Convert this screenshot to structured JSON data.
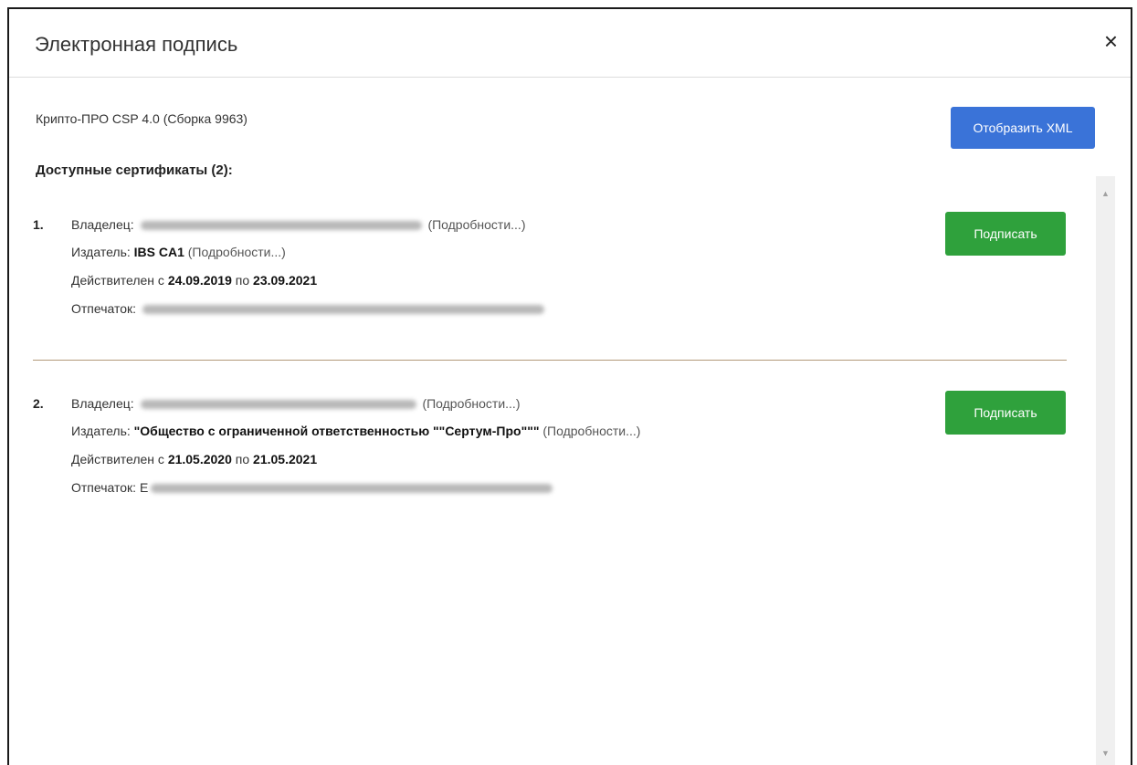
{
  "dialog": {
    "title": "Электронная подпись",
    "close_glyph": "×"
  },
  "csp_info": "Крипто-ПРО CSP 4.0 (Сборка 9963)",
  "xml_button_label": "Отобразить XML",
  "certs_heading": "Доступные сертификаты (2):",
  "certificates": [
    {
      "number": "1.",
      "owner_label": "Владелец:",
      "owner_details": "(Подробности...)",
      "issuer_label": "Издатель:",
      "issuer_value": "IBS CA1",
      "issuer_details": "(Подробности...)",
      "valid_prefix": "Действителен с",
      "valid_from": "24.09.2019",
      "valid_mid": "по",
      "valid_to": "23.09.2021",
      "thumbprint_label": "Отпечаток:",
      "sign_label": "Подписать"
    },
    {
      "number": "2.",
      "owner_label": "Владелец:",
      "owner_details": "(Подробности...)",
      "issuer_label": "Издатель:",
      "issuer_value": "\"Общество с ограниченной ответственностью \"\"Сертум-Про\"\"\"",
      "issuer_details": "(Подробности...)",
      "valid_prefix": "Действителен с",
      "valid_from": "21.05.2020",
      "valid_mid": "по",
      "valid_to": "21.05.2021",
      "thumbprint_label": "Отпечаток:",
      "thumbprint_visible_prefix": "E",
      "sign_label": "Подписать"
    }
  ],
  "colors": {
    "xml_button": "#3a73d8",
    "sign_button": "#2fa13c",
    "divider": "#b39a7a"
  },
  "icons": {
    "close": "close-icon",
    "scroll_up": "arrow-up-icon",
    "scroll_down": "arrow-down-icon"
  }
}
